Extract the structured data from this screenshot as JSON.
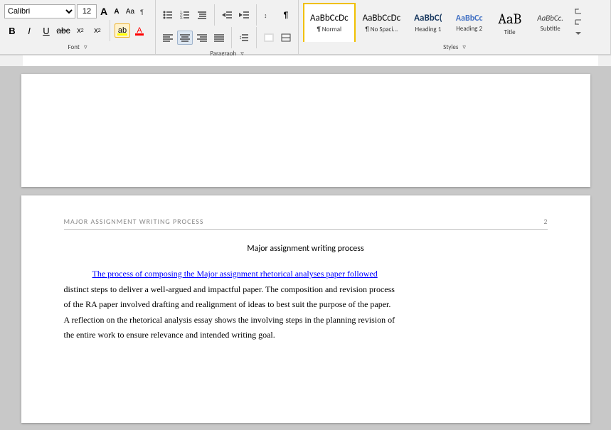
{
  "ribbon": {
    "font_size": "12",
    "font_name": "Calibri",
    "styles": [
      {
        "id": "normal",
        "label": "¶ Normal",
        "preview": "AaBbCcDc",
        "active": true,
        "preview_size": "13px",
        "preview_color": "#000"
      },
      {
        "id": "no-spacing",
        "label": "¶ No Spaci...",
        "preview": "AaBbCcDc",
        "active": false,
        "preview_size": "13px",
        "preview_color": "#000"
      },
      {
        "id": "heading1",
        "label": "Heading 1",
        "preview": "AaBbC(",
        "active": false,
        "preview_size": "13px",
        "preview_color": "#17375e"
      },
      {
        "id": "heading2",
        "label": "Heading 2",
        "preview": "AaBbCc",
        "active": false,
        "preview_size": "12px",
        "preview_color": "#4472c4"
      },
      {
        "id": "title",
        "label": "Title",
        "preview": "AaB",
        "active": false,
        "preview_size": "20px",
        "preview_color": "#000"
      },
      {
        "id": "subtitle",
        "label": "Subtitle",
        "preview": "AaBbCc.",
        "active": false,
        "preview_size": "11px",
        "preview_color": "#404040"
      }
    ],
    "sections": {
      "font": "Font",
      "paragraph": "Paragraph",
      "styles": "Styles"
    }
  },
  "ruler": {
    "visible": true
  },
  "page1": {
    "content": "(empty upper page)"
  },
  "page2": {
    "header_title": "MAJOR ASSIGNMENT WRITING PROCESS",
    "page_number": "2",
    "doc_title": "Major assignment writing process",
    "body_text_1": "The process of composing the Major assignment rhetorical analyses paper followed",
    "body_text_1_link": "The process of composing the Major assignment rhetorical analyses paper followed",
    "body_text_2": "distinct steps to deliver a well-argued and impactful paper. The composition and revision process",
    "body_text_3": "of the RA paper involved drafting and realignment of ideas to best suit the purpose of the paper.",
    "body_text_4": "A reflection on the rhetorical analysis essay shows the involving steps in the planning revision of",
    "body_text_5": "the entire work to ensure relevance and intended writing goal."
  }
}
